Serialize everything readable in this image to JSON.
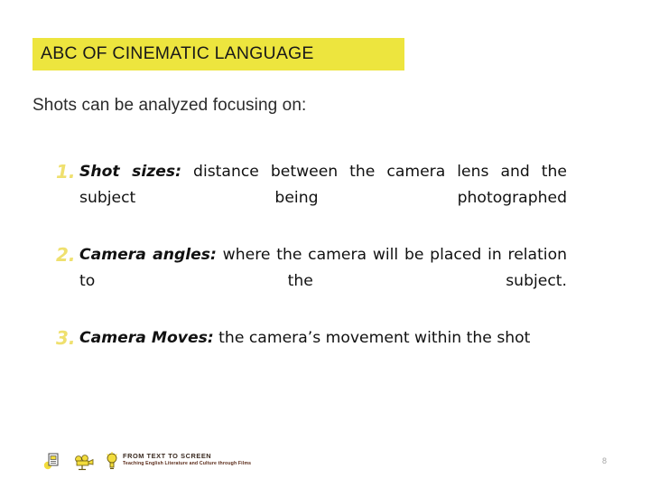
{
  "slide": {
    "title": "ABC OF CINEMATIC LANGUAGE",
    "intro": "Shots can be analyzed focusing on:",
    "page_number": "8",
    "colors": {
      "title_highlight": "#EDE53E",
      "number_yellow": "#EFE06E",
      "body_text": "#111111",
      "page_number": "#A6A6A6",
      "icon_yellow": "#F2DC3C"
    }
  },
  "items": [
    {
      "number": "1.",
      "lead": "Shot sizes:",
      "text": " distance between the camera lens and the subject being photographed"
    },
    {
      "number": "2.",
      "lead": "Camera angles:",
      "text": " where the camera will be placed in relation to the subject."
    },
    {
      "number": "3.",
      "lead": "Camera Moves:",
      "text": " the camera’s movement within the shot"
    }
  ],
  "footer": {
    "brand_main": "FROM TEXT TO SCREEN",
    "brand_sub": "Teaching English Literature and Culture through Films",
    "icons": [
      {
        "name": "book-icon"
      },
      {
        "name": "film-camera-icon"
      },
      {
        "name": "lightbulb-icon"
      }
    ]
  }
}
